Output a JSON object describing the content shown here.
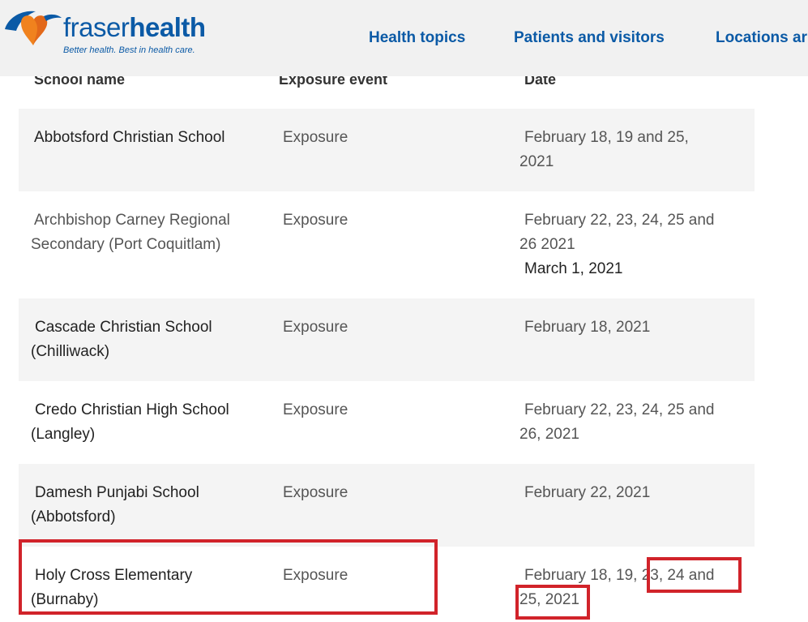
{
  "header": {
    "logo": {
      "word_light": "fraser",
      "word_bold": "health",
      "tagline": "Better health. Best in health care."
    },
    "nav": [
      {
        "label": "Health topics"
      },
      {
        "label": "Patients and visitors"
      },
      {
        "label": "Locations ar"
      }
    ]
  },
  "table": {
    "headers": {
      "school": "School name",
      "event": "Exposure event",
      "date": "Date"
    },
    "rows": [
      {
        "school": [
          "Abbotsford Christian School"
        ],
        "event": "Exposure",
        "date": [
          "February 18, 19 and 25,",
          "2021"
        ]
      },
      {
        "school": [
          "Archbishop Carney Regional",
          "Secondary (Port Coquitlam)"
        ],
        "event": "Exposure",
        "date": [
          "February 22, 23, 24, 25 and",
          "26 2021",
          "March 1, 2021"
        ]
      },
      {
        "school": [
          "Cascade Christian School",
          "(Chilliwack)"
        ],
        "event": "Exposure",
        "date": [
          "February 18, 2021"
        ]
      },
      {
        "school": [
          "Credo Christian High School",
          "(Langley)"
        ],
        "event": "Exposure",
        "date": [
          "February 22, 23, 24, 25 and",
          "26, 2021"
        ]
      },
      {
        "school": [
          "Damesh Punjabi School",
          "(Abbotsford)"
        ],
        "event": "Exposure",
        "date": [
          "February 22, 2021"
        ]
      },
      {
        "school": [
          "Holy Cross Elementary",
          "(Burnaby)"
        ],
        "event": "Exposure",
        "date": [
          "February 18, 19, 23, 24 and",
          "25, 2021"
        ]
      }
    ]
  },
  "colors": {
    "brand_blue": "#0b5aa6",
    "brand_orange": "#f0821e",
    "highlight_red": "#d1232a",
    "row_shade": "#f4f4f4"
  }
}
